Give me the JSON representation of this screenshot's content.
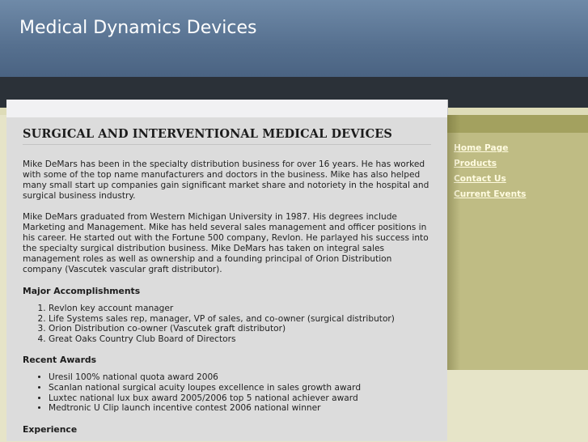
{
  "site": {
    "title": "Medical Dynamics Devices"
  },
  "nav": {
    "items": [
      {
        "label": "Home Page"
      },
      {
        "label": "Products"
      },
      {
        "label": "Contact Us"
      },
      {
        "label": "Current Events"
      }
    ]
  },
  "content": {
    "heading": "SURGICAL AND INTERVENTIONAL MEDICAL DEVICES",
    "paragraph1": "Mike DeMars has been in the specialty distribution business for over 16 years.  He has worked with some of the top name manufacturers and doctors in the business.  Mike has also helped many small start up companies gain significant  market share and notoriety in the hospital and surgical business industry.",
    "paragraph2": "Mike DeMars graduated from Western Michigan University in 1987.  His degrees include Marketing and Management.  Mike has held several sales management and officer positions in his career.  He started out with the Fortune 500 company, Revlon.  He parlayed his success into the specialty surgical distribution business.  Mike DeMars has taken on integral sales management roles as well as ownership and a founding principal of Orion Distribution company (Vascutek vascular graft distributor).",
    "accomplishments": {
      "title": "Major Accomplishments",
      "items": [
        "Revlon key account manager",
        "Life Systems sales rep, manager, VP of sales, and co-owner (surgical distributor)",
        "Orion Distribution co-owner (Vascutek graft distributor)",
        "Great Oaks Country Club Board of Directors"
      ]
    },
    "awards": {
      "title": "Recent Awards",
      "items": [
        "Uresil 100% national quota award 2006",
        "Scanlan national surgical acuity loupes excellence in sales growth award",
        "Luxtec national lux bux award 2005/2006 top 5 national achiever award",
        "Medtronic U Clip launch incentive contest 2006 national winner"
      ]
    },
    "experience": {
      "title": "Experience"
    }
  }
}
